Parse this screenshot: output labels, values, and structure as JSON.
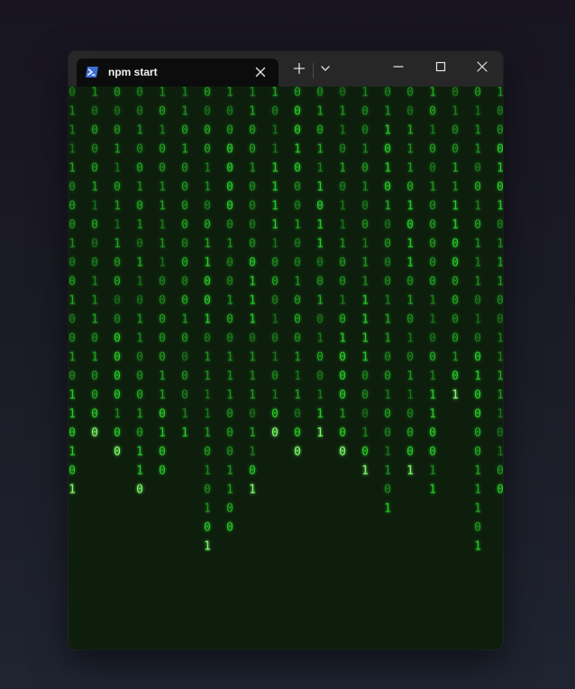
{
  "window": {
    "tab_title": "npm start",
    "tab_icon": "powershell-icon",
    "new_tab_label": "+",
    "colors": {
      "titlebar": "#272727",
      "active_tab": "#0c0c0c",
      "terminal_bg": "#0d1f0c",
      "rain_green": "#2bd62b",
      "rain_head": "#7dff6a"
    }
  },
  "terminal": {
    "effect": "matrix-rain",
    "charset": [
      "0",
      "1"
    ]
  }
}
